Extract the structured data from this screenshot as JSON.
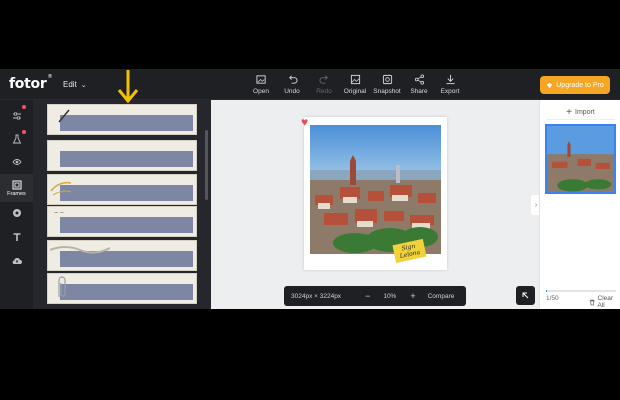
{
  "app": {
    "logo": "fotor",
    "logo_mark": "®"
  },
  "topbar": {
    "edit_label": "Edit",
    "tools": [
      {
        "label": "Open",
        "icon": "image-plus-icon"
      },
      {
        "label": "Undo",
        "icon": "undo-icon"
      },
      {
        "label": "Redo",
        "icon": "redo-icon"
      },
      {
        "label": "Original",
        "icon": "image-icon"
      },
      {
        "label": "Snapshot",
        "icon": "snapshot-icon"
      },
      {
        "label": "Share",
        "icon": "share-icon"
      },
      {
        "label": "Export",
        "icon": "download-icon"
      }
    ],
    "upgrade_label": "Upgrade to Pro"
  },
  "rail": {
    "frames_label": "Frames"
  },
  "canvas": {
    "dimensions": "3024px × 3224px",
    "zoom_value": "10%",
    "zoom_minus": "−",
    "zoom_plus": "+",
    "compare_label": "Compare",
    "signature_line1": "Sign",
    "signature_line2": "Lelona"
  },
  "rpanel": {
    "import_label": "Import",
    "count_current": "1",
    "count_total": "/50",
    "clear_all_label": "Clear All",
    "progress_fraction": 0.02
  },
  "colors": {
    "accent": "#f5a623",
    "selection": "#3b82f6",
    "arrow": "#f2c200"
  }
}
